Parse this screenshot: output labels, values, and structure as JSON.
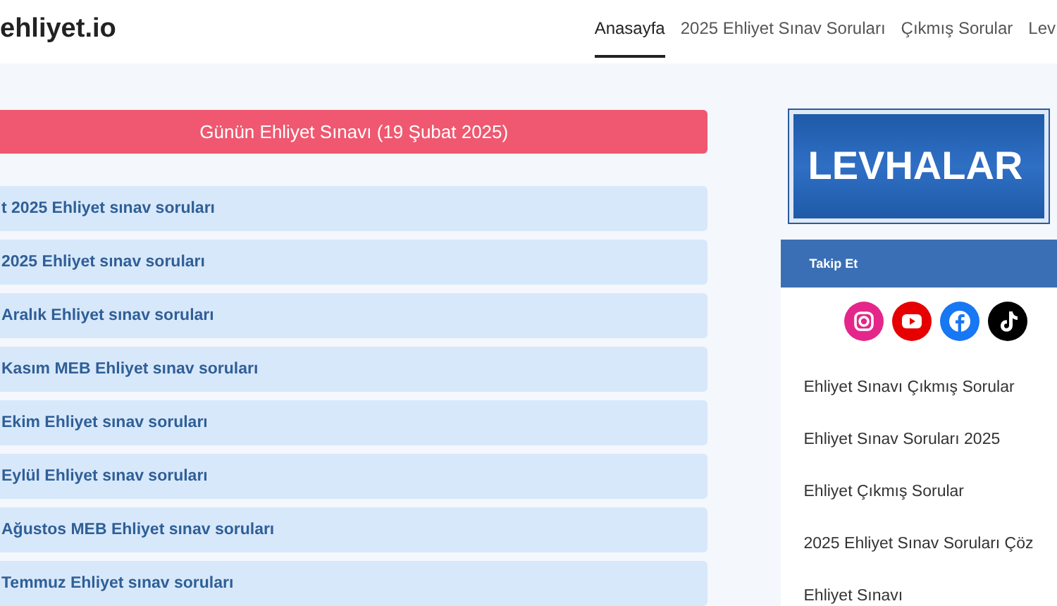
{
  "header": {
    "logo": "ehliyet.io",
    "nav": [
      {
        "label": "Anasayfa",
        "selected": true
      },
      {
        "label": "2025 Ehliyet Sınav Soruları",
        "selected": false
      },
      {
        "label": "Çıkmış Sorular",
        "selected": false
      },
      {
        "label": "Lev",
        "selected": false
      }
    ]
  },
  "main": {
    "banner": "Günün Ehliyet Sınavı (19 Şubat 2025)",
    "links": [
      "t 2025 Ehliyet sınav soruları",
      "2025 Ehliyet sınav soruları",
      "Aralık Ehliyet sınav soruları",
      "Kasım MEB Ehliyet sınav soruları",
      "Ekim Ehliyet sınav soruları",
      "Eylül Ehliyet sınav soruları",
      "Ağustos MEB Ehliyet sınav soruları",
      "Temmuz Ehliyet sınav soruları"
    ]
  },
  "sidebar": {
    "sign_text": "LEVHALAR",
    "follow_title": "Takip Et",
    "social": [
      {
        "kind": "instagram",
        "color": "#e4268a"
      },
      {
        "kind": "youtube",
        "color": "#e60000"
      },
      {
        "kind": "facebook",
        "color": "#1877f2"
      },
      {
        "kind": "tiktok",
        "color": "#000000"
      }
    ],
    "links": [
      "Ehliyet Sınavı Çıkmış Sorular",
      "Ehliyet Sınav Soruları 2025",
      "Ehliyet Çıkmış Sorular",
      "2025 Ehliyet Sınav Soruları Çöz",
      "Ehliyet Sınavı"
    ]
  }
}
